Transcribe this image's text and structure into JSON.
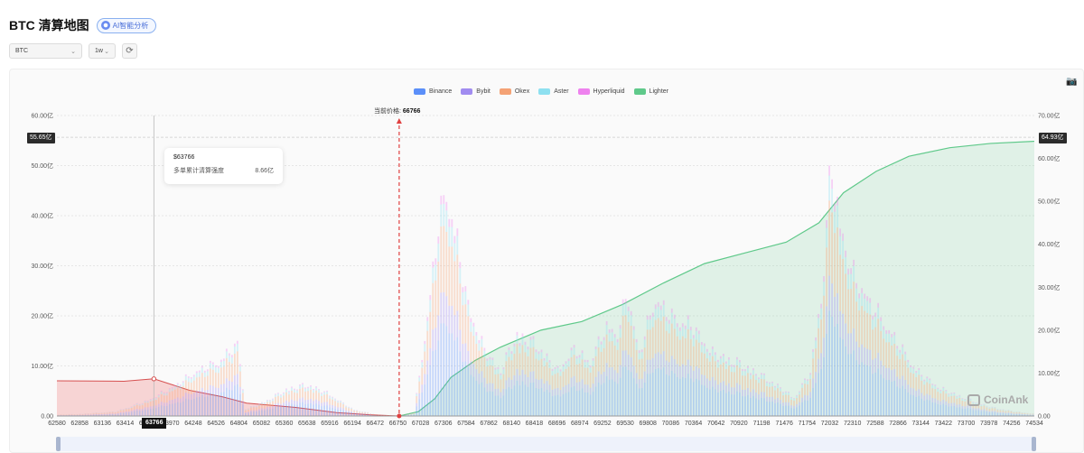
{
  "header": {
    "title": "BTC 清算地图",
    "ai_label": "AI智能分析"
  },
  "controls": {
    "symbol": "BTC",
    "range": "1w"
  },
  "current_price_label": "当前价格:",
  "current_price": "66766",
  "tooltip": {
    "title": "$63766",
    "label": "多单累计清算强度",
    "value": "8.66亿"
  },
  "crosshair": {
    "left_value": "55.65亿",
    "right_value": "64.93亿",
    "x_value": "63766"
  },
  "watermark": "CoinAnk",
  "colors": {
    "Binance": "#5b8ff9",
    "Bybit": "#a18cf0",
    "Okex": "#f4a275",
    "Aster": "#8ee0f0",
    "Hyperliquid": "#ee82ee",
    "Lighter": "#5fc98a",
    "short_area": "#f4b4b4",
    "price_line": "#e04040"
  },
  "chart_data": {
    "type": "bar",
    "legend": [
      "Binance",
      "Bybit",
      "Okex",
      "Aster",
      "Hyperliquid",
      "Lighter"
    ],
    "legend_position": "top-center",
    "x_tick_labels": [
      "62580",
      "62858",
      "63136",
      "63414",
      "63692",
      "63970",
      "64248",
      "64526",
      "64804",
      "65082",
      "65360",
      "65638",
      "65916",
      "66194",
      "66472",
      "66750",
      "67028",
      "67306",
      "67584",
      "67862",
      "68140",
      "68418",
      "68696",
      "68974",
      "69252",
      "69530",
      "69808",
      "70086",
      "70364",
      "70642",
      "70920",
      "71198",
      "71476",
      "71754",
      "72032",
      "72310",
      "72588",
      "72866",
      "73144",
      "73422",
      "73700",
      "73978",
      "74256",
      "74534"
    ],
    "x_range": [
      62580,
      74534
    ],
    "y_left": {
      "ticks": [
        "0.00",
        "10.00亿",
        "20.00亿",
        "30.00亿",
        "40.00亿",
        "50.00亿",
        "60.00亿"
      ],
      "range": [
        0,
        60
      ],
      "unit": "亿"
    },
    "y_right": {
      "ticks": [
        "0.00",
        "10.00亿",
        "20.00亿",
        "30.00亿",
        "40.00亿",
        "50.00亿",
        "60.00亿",
        "70.00亿"
      ],
      "range": [
        0,
        70
      ],
      "unit": "亿"
    },
    "current_price": 66766,
    "bar_profile": [
      [
        62580,
        0.3
      ],
      [
        62900,
        0.5
      ],
      [
        63300,
        1.0
      ],
      [
        63700,
        3.5
      ],
      [
        64000,
        6.5
      ],
      [
        64300,
        10.0
      ],
      [
        64550,
        12.0
      ],
      [
        64800,
        16.0
      ],
      [
        64880,
        1.5
      ],
      [
        65100,
        3.0
      ],
      [
        65400,
        6.0
      ],
      [
        65650,
        7.0
      ],
      [
        65900,
        5.0
      ],
      [
        66200,
        1.5
      ],
      [
        66500,
        0.3
      ],
      [
        66760,
        0.1
      ],
      [
        66950,
        0.8
      ],
      [
        67100,
        20.0
      ],
      [
        67250,
        43.0
      ],
      [
        67350,
        50.0
      ],
      [
        67500,
        36.0
      ],
      [
        67600,
        25.0
      ],
      [
        67800,
        15.0
      ],
      [
        68000,
        10.0
      ],
      [
        68200,
        18.0
      ],
      [
        68450,
        16.0
      ],
      [
        68700,
        10.0
      ],
      [
        68900,
        15.0
      ],
      [
        69100,
        12.0
      ],
      [
        69300,
        20.0
      ],
      [
        69450,
        18.0
      ],
      [
        69550,
        28.0
      ],
      [
        69700,
        14.0
      ],
      [
        69900,
        26.0
      ],
      [
        70100,
        22.0
      ],
      [
        70350,
        20.0
      ],
      [
        70600,
        14.0
      ],
      [
        70900,
        12.0
      ],
      [
        71100,
        10.0
      ],
      [
        71300,
        8.0
      ],
      [
        71600,
        4.0
      ],
      [
        71800,
        10.0
      ],
      [
        71950,
        30.0
      ],
      [
        72050,
        57.0
      ],
      [
        72150,
        43.0
      ],
      [
        72300,
        32.0
      ],
      [
        72500,
        26.0
      ],
      [
        72800,
        18.0
      ],
      [
        73100,
        10.0
      ],
      [
        73400,
        6.0
      ],
      [
        73700,
        4.0
      ],
      [
        74000,
        2.0
      ],
      [
        74300,
        1.0
      ],
      [
        74534,
        0.5
      ]
    ],
    "cumulative_long_liquidation": [
      [
        62580,
        8.2
      ],
      [
        63400,
        8.1
      ],
      [
        63766,
        8.66
      ],
      [
        64200,
        6.0
      ],
      [
        64600,
        4.5
      ],
      [
        64900,
        3.0
      ],
      [
        65500,
        2.0
      ],
      [
        66000,
        0.8
      ],
      [
        66400,
        0.3
      ],
      [
        66766,
        0.0
      ]
    ],
    "cumulative_short_liquidation": [
      [
        66766,
        0.0
      ],
      [
        67000,
        1.0
      ],
      [
        67200,
        4.0
      ],
      [
        67400,
        9.0
      ],
      [
        67700,
        13.0
      ],
      [
        68000,
        16.0
      ],
      [
        68500,
        20.0
      ],
      [
        69000,
        22.0
      ],
      [
        69500,
        26.0
      ],
      [
        70000,
        31.0
      ],
      [
        70500,
        35.5
      ],
      [
        71000,
        38.0
      ],
      [
        71500,
        40.5
      ],
      [
        71900,
        45.0
      ],
      [
        72200,
        52.0
      ],
      [
        72600,
        57.0
      ],
      [
        73000,
        60.5
      ],
      [
        73500,
        62.5
      ],
      [
        74000,
        63.5
      ],
      [
        74534,
        64.0
      ]
    ]
  }
}
